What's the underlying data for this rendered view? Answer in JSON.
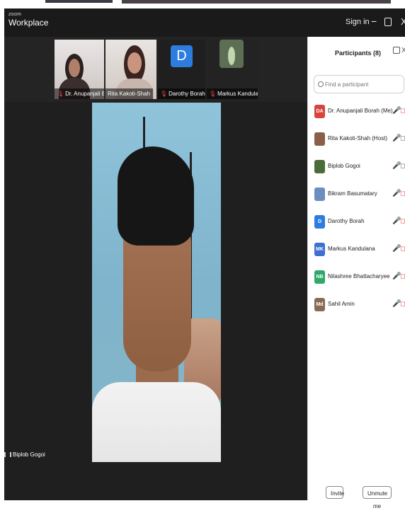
{
  "app": {
    "brand_top": "zoom",
    "brand_main": "Workplace",
    "sign_in": "Sign in",
    "minimize": "−",
    "close": "X"
  },
  "thumbnails": [
    {
      "name": "Dr. Anupanjali Borah",
      "muted": true
    },
    {
      "name": "Rita Kakoti-Shah",
      "muted": false
    },
    {
      "name": "Darothy Borah",
      "muted": true,
      "avatar_letter": "D"
    },
    {
      "name": "Markus Kandulana",
      "muted": true
    }
  ],
  "main_video": {
    "name": "Biplob Gogoi"
  },
  "participants_panel": {
    "title": "Participants (8)",
    "close": "X",
    "search_placeholder": "Find a participant",
    "participants": [
      {
        "name": "Dr. Anupanjali Borah (Me)",
        "initials": "DA",
        "color": "#d9443e",
        "mic": "muted",
        "mic_icon": "🎤",
        "cam_icon": "◻"
      },
      {
        "name": "Rita Kakoti-Shah (Host)",
        "initials": "",
        "color": "#8b5e4a",
        "mic": "unmuted",
        "mic_icon": "🎤",
        "cam_icon": "◻"
      },
      {
        "name": "Biplob Gogoi",
        "initials": "",
        "color": "#4a6b3a",
        "mic": "unmuted",
        "mic_icon": "🎤",
        "cam_icon": "◻"
      },
      {
        "name": "Bikram Basumatary",
        "initials": "",
        "color": "#6a8fbf",
        "mic": "muted",
        "mic_icon": "🎤",
        "cam_icon": "◻"
      },
      {
        "name": "Darothy Borah",
        "initials": "D",
        "color": "#2d7ce0",
        "mic": "muted",
        "mic_icon": "🎤",
        "cam_icon": "◻"
      },
      {
        "name": "Markus Kandulana",
        "initials": "MK",
        "color": "#3f6fd1",
        "mic": "muted",
        "mic_icon": "🎤",
        "cam_icon": "◻"
      },
      {
        "name": "Nilashree Bhattacharyee",
        "initials": "NB",
        "color": "#2fa86a",
        "mic": "muted",
        "mic_icon": "🎤",
        "cam_icon": "◻"
      },
      {
        "name": "Sahil Amin",
        "initials": "Md",
        "color": "#8a6a55",
        "mic": "muted",
        "mic_icon": "🎤",
        "cam_icon": "◻"
      }
    ],
    "invite_label": "Invite",
    "unmute_label": "Unmute me"
  }
}
